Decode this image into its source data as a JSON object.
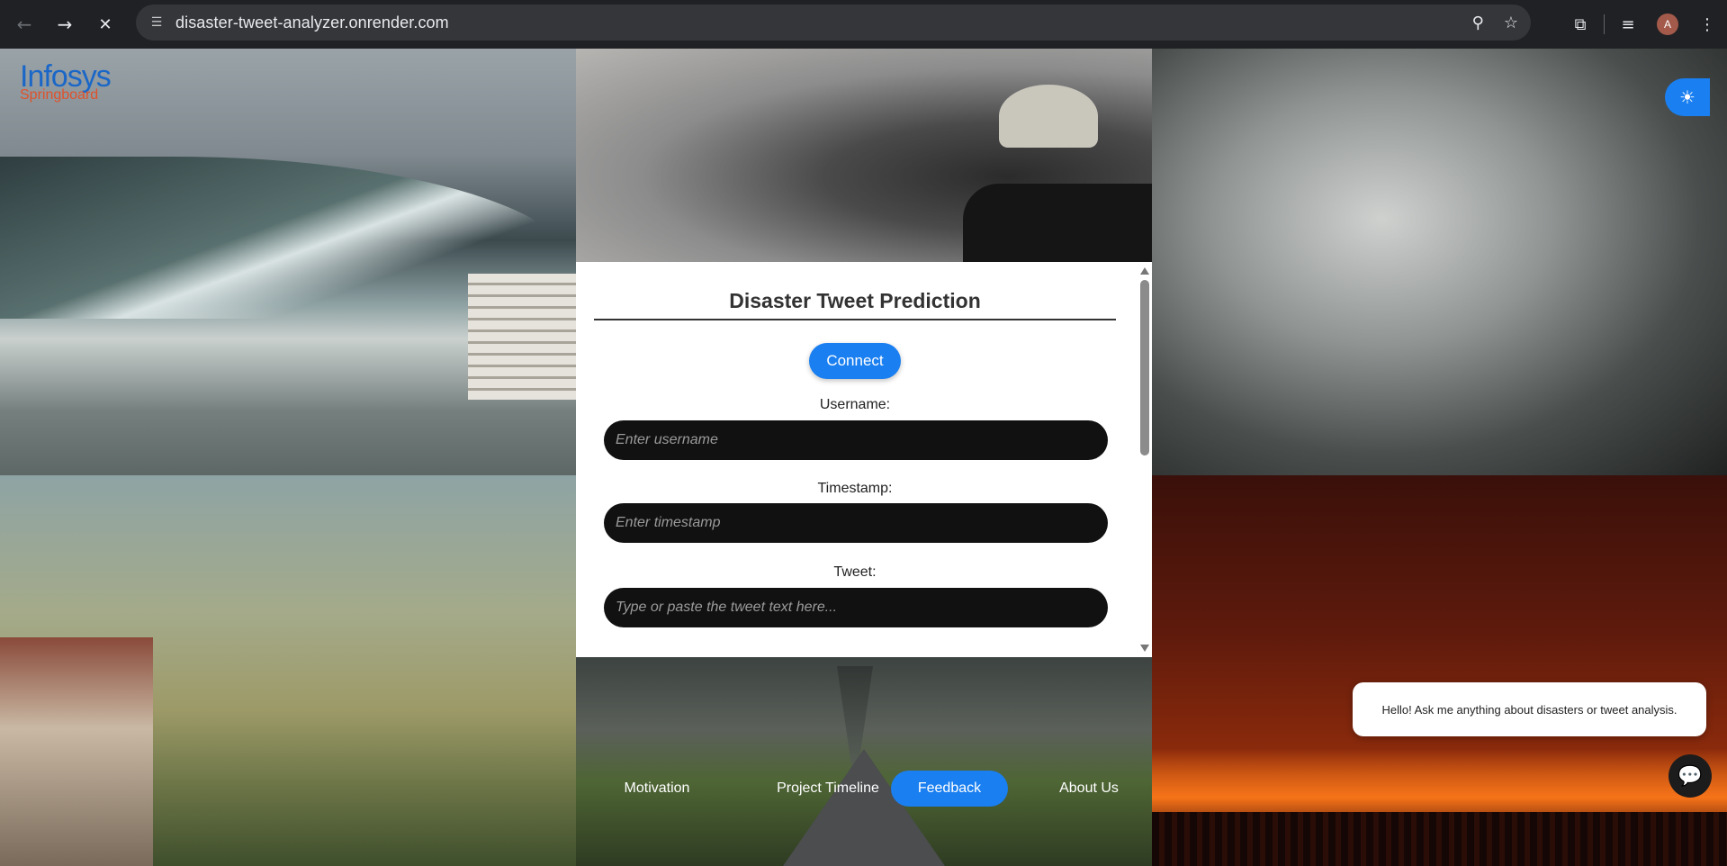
{
  "browser": {
    "back_icon": "←",
    "forward_icon": "→",
    "stop_icon": "✕",
    "site_info_icon": "☰",
    "url": "disaster-tweet-analyzer.onrender.com",
    "zoom_icon": "⚲",
    "star_icon": "☆",
    "extensions_icon": "⧉",
    "media_icon": "≡",
    "profile_initial": "A",
    "menu_icon": "⋮"
  },
  "logo": {
    "line1": "Infosys",
    "line2": "Springboard"
  },
  "theme_toggle_icon": "☀",
  "form": {
    "title": "Disaster Tweet Prediction",
    "connect_label": "Connect",
    "username_label": "Username:",
    "username_placeholder": "Enter username",
    "timestamp_label": "Timestamp:",
    "timestamp_placeholder": "Enter timestamp",
    "tweet_label": "Tweet:",
    "tweet_placeholder": "Type or paste the tweet text here..."
  },
  "nav": {
    "items": [
      {
        "label": "Motivation"
      },
      {
        "label": "Project Timeline"
      },
      {
        "label": "Feedback",
        "active": true
      },
      {
        "label": "About Us"
      }
    ]
  },
  "chat": {
    "greeting": "Hello! Ask me anything about disasters or tweet analysis.",
    "button_icon": "💬"
  },
  "colors": {
    "accent": "#1a7ff0",
    "field_bg": "#111111"
  }
}
